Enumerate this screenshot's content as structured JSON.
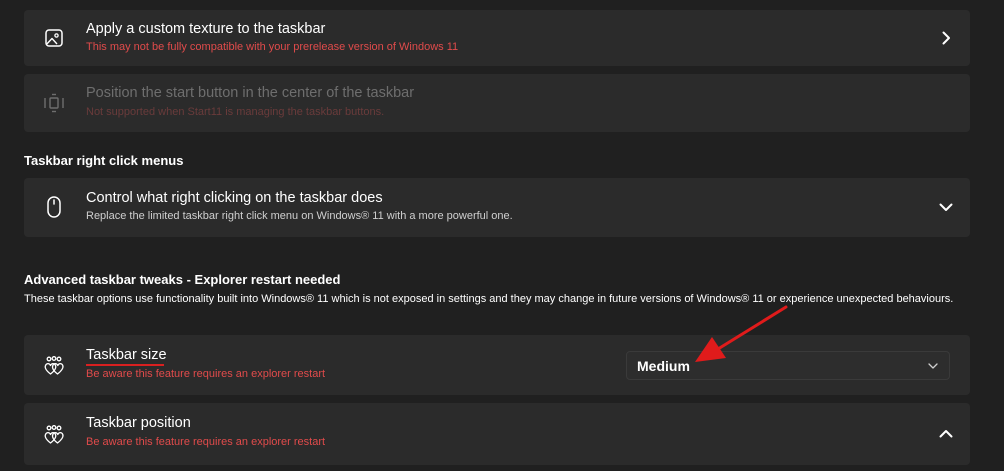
{
  "texture_card": {
    "title": "Apply a custom texture to the taskbar",
    "subtitle": "This may not be fully compatible with your prerelease version of Windows 11"
  },
  "center_card": {
    "title": "Position the start button in the center of the taskbar",
    "subtitle": "Not supported when Start11 is managing the taskbar buttons."
  },
  "right_click_section": {
    "heading": "Taskbar right click menus"
  },
  "right_click_card": {
    "title": "Control what right clicking on the taskbar does",
    "subtitle": "Replace the limited taskbar right click menu on Windows® 11 with a more powerful one."
  },
  "advanced_section": {
    "heading": "Advanced taskbar tweaks - Explorer restart needed",
    "description": "These taskbar options use functionality built into Windows® 11 which is not exposed in settings and they may change in future versions of Windows® 11 or experience unexpected behaviours."
  },
  "taskbar_size_card": {
    "title": "Taskbar size",
    "subtitle": "Be aware this feature requires an explorer restart",
    "selected": "Medium"
  },
  "taskbar_position_card": {
    "title": "Taskbar position",
    "subtitle": "Be aware this feature requires an explorer restart"
  },
  "colors": {
    "background": "#202020",
    "card": "#2b2b2b",
    "warning_red": "#e04b4b",
    "annotation_red": "#e01b1b"
  },
  "icons": {
    "texture": "image-icon",
    "center": "taskbar-center-icon",
    "right_click": "mouse-icon",
    "size": "hearts-icon",
    "position": "hearts-icon"
  }
}
